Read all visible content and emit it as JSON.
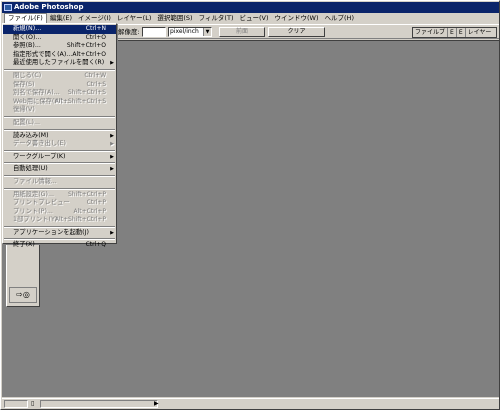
{
  "window": {
    "title": "Adobe Photoshop"
  },
  "menubar": [
    "ファイル(F)",
    "編集(E)",
    "イメージ(I)",
    "レイヤー(L)",
    "選択範囲(S)",
    "フィルタ(T)",
    "ビュー(V)",
    "ウインドウ(W)",
    "ヘルプ(H)"
  ],
  "options": {
    "resolution_label": "解像度:",
    "resolution_value": "",
    "unit_select": "pixel/inch",
    "front_image_button": "前面",
    "clear_button": "クリア",
    "palette_tabs": [
      "ファイルブ",
      "E",
      "E",
      "レイヤー"
    ]
  },
  "file_menu": [
    {
      "label": "新規(N)...",
      "shortcut": "Ctrl+N",
      "state": "highlight"
    },
    {
      "label": "開く(O)...",
      "shortcut": "Ctrl+O"
    },
    {
      "label": "参照(B)...",
      "shortcut": "Shift+Ctrl+O"
    },
    {
      "label": "指定形式で開く(A)...",
      "shortcut": "Alt+Ctrl+O"
    },
    {
      "label": "最近使用したファイルを開く(R)",
      "submenu": true
    },
    {
      "sep": true
    },
    {
      "label": "閉じる(C)",
      "shortcut": "Ctrl+W",
      "state": "disabled"
    },
    {
      "label": "保存(S)",
      "shortcut": "Ctrl+S",
      "state": "disabled"
    },
    {
      "label": "別名で保存(A)...",
      "shortcut": "Shift+Ctrl+S",
      "state": "disabled"
    },
    {
      "label": "Web用に保存(W)...",
      "shortcut": "Alt+Shift+Ctrl+S",
      "state": "disabled"
    },
    {
      "label": "復帰(V)",
      "state": "disabled"
    },
    {
      "sep": true
    },
    {
      "label": "配置(L)...",
      "state": "disabled"
    },
    {
      "sep": true
    },
    {
      "label": "読み込み(M)",
      "submenu": true
    },
    {
      "label": "データ書き出し(E)",
      "submenu": true,
      "state": "disabled"
    },
    {
      "sep": true
    },
    {
      "label": "ワークグループ(K)",
      "submenu": true
    },
    {
      "sep": true
    },
    {
      "label": "自動処理(U)",
      "submenu": true
    },
    {
      "sep": true
    },
    {
      "label": "ファイル情報...",
      "state": "disabled"
    },
    {
      "sep": true
    },
    {
      "label": "用紙設定(G)...",
      "shortcut": "Shift+Ctrl+P",
      "state": "disabled"
    },
    {
      "label": "プリントプレビュー",
      "shortcut": "Ctrl+P",
      "state": "disabled"
    },
    {
      "label": "プリント(P)...",
      "shortcut": "Alt+Ctrl+P",
      "state": "disabled"
    },
    {
      "label": "1部プリント(Y)",
      "shortcut": "Alt+Shift+Ctrl+P",
      "state": "disabled"
    },
    {
      "sep": true
    },
    {
      "label": "アプリケーションを起動(J)",
      "submenu": true
    },
    {
      "sep": true
    },
    {
      "label": "終了(X)",
      "shortcut": "Ctrl+Q"
    }
  ],
  "status": {
    "zoom": ""
  }
}
